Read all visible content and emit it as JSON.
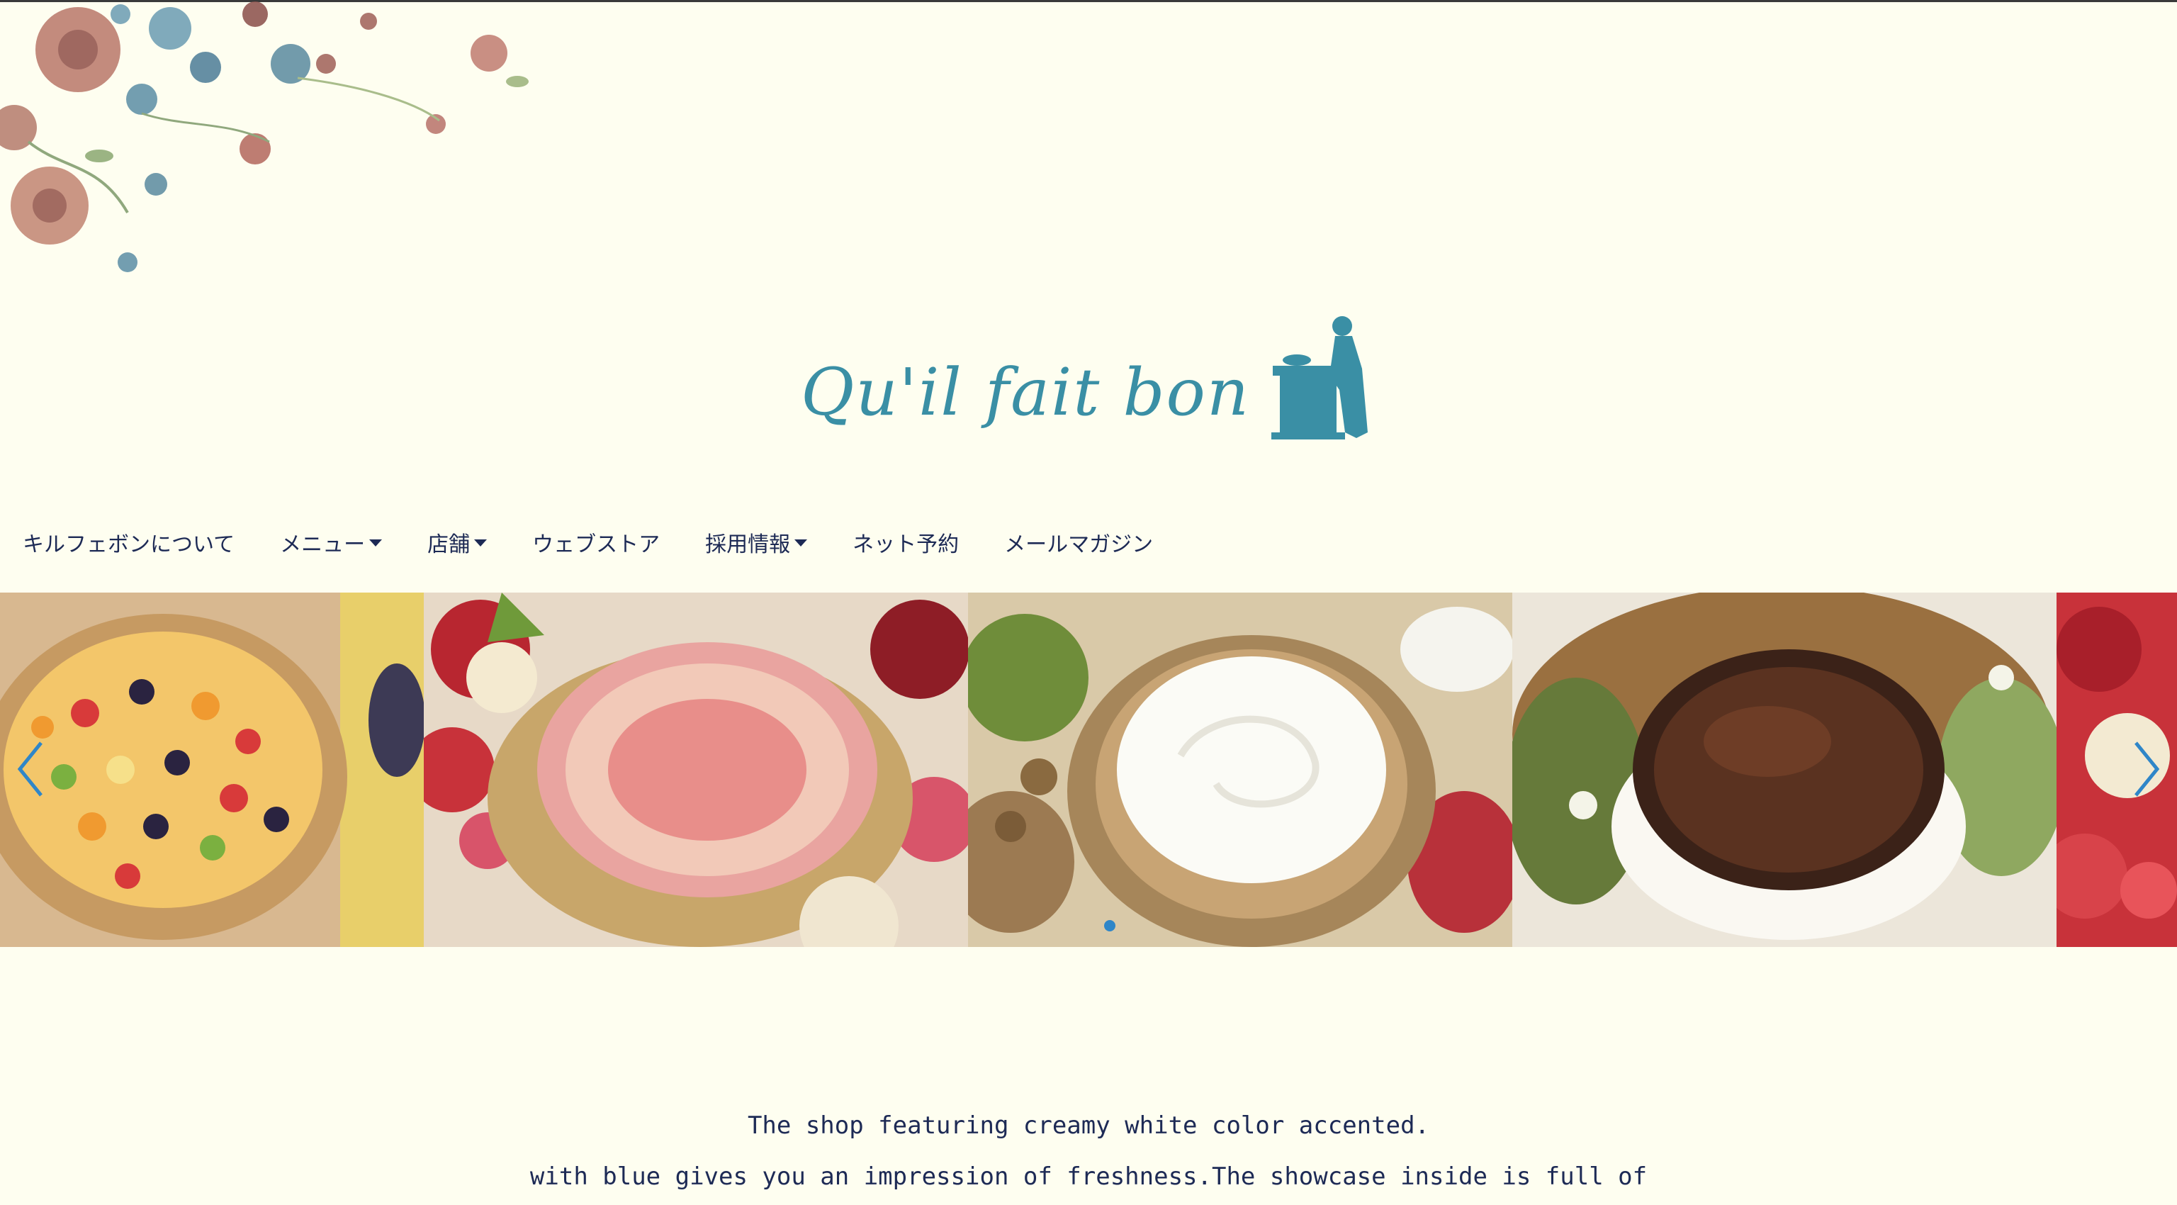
{
  "brand": {
    "logo_text": "Qu'il fait bon",
    "logo_color": "#3a8fa5"
  },
  "nav": {
    "items": [
      {
        "label": "キルフェボンについて",
        "has_dropdown": false
      },
      {
        "label": "メニュー",
        "has_dropdown": true
      },
      {
        "label": "店舗",
        "has_dropdown": true
      },
      {
        "label": "ウェブストア",
        "has_dropdown": false
      },
      {
        "label": "採用情報",
        "has_dropdown": true
      },
      {
        "label": "ネット予約",
        "has_dropdown": false
      },
      {
        "label": "メールマガジン",
        "has_dropdown": false
      }
    ]
  },
  "carousel": {
    "prev_icon": "chevron-left-icon",
    "next_icon": "chevron-right-icon",
    "active_dot_color": "#2f86c8",
    "slides": [
      "fruit-tart-image",
      "apple-tart-image",
      "cream-walnut-tart-image",
      "chocolate-tart-image",
      "apple-strawberry-image"
    ]
  },
  "intro": {
    "line1": "The shop featuring creamy white color accented.",
    "line2": "with blue gives you an impression of freshness.The showcase inside is full of"
  },
  "colors": {
    "background": "#fefef0",
    "nav_text": "#1d2a55",
    "accent": "#3a8fa5"
  }
}
